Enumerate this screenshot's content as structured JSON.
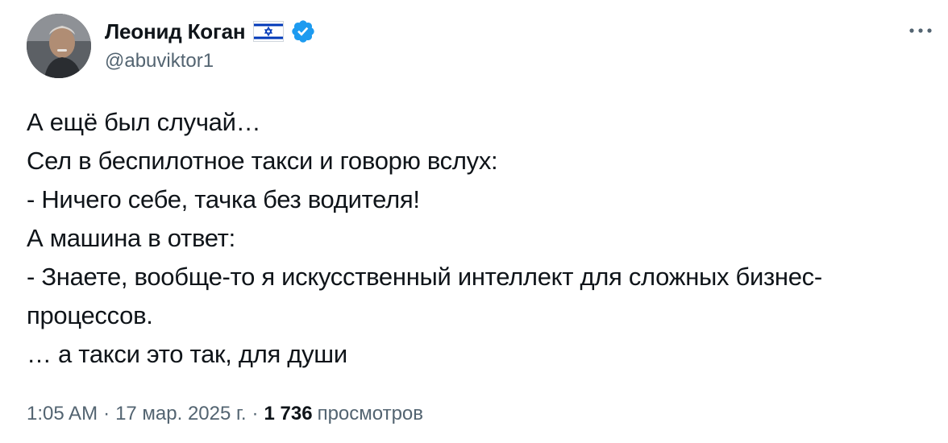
{
  "author": {
    "display_name": "Леонид Коган",
    "handle": "@abuviktor1",
    "flag_icon": "israel-flag-icon",
    "verified_icon": "verified-badge-icon",
    "verified_color": "#1d9bf0",
    "avatar": "profile-photo"
  },
  "tweet": {
    "lines": [
      "А ещё был случай…",
      "Сел в беспилотное такси и говорю вслух:",
      "- Ничего себе, тачка без водителя!",
      "А машина в ответ:",
      "- Знаете, вообще-то я искусственный интеллект для сложных бизнес-",
      "процессов.",
      "… а такси это так, для души"
    ]
  },
  "meta": {
    "time": "1:05 AM",
    "separator": "·",
    "date": "17 мар. 2025 г.",
    "views_count": "1 736",
    "views_label": "просмотров"
  },
  "more_icon": "more-horizontal-icon",
  "colors": {
    "text_primary": "#0f1419",
    "text_secondary": "#536471",
    "accent": "#1d9bf0"
  }
}
